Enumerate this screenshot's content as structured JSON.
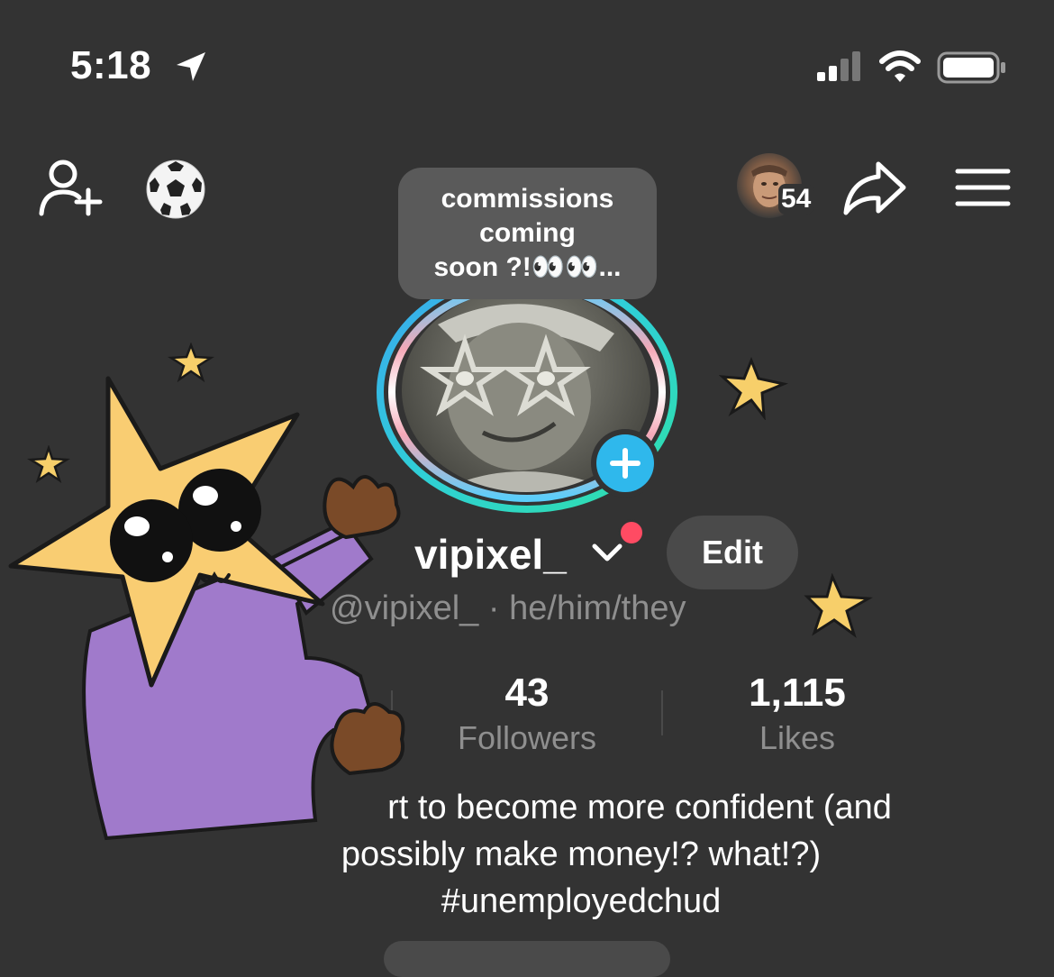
{
  "status_bar": {
    "time": "5:18",
    "icons": [
      "location-arrow-icon",
      "signal-icon",
      "wifi-icon",
      "battery-icon"
    ]
  },
  "top_nav": {
    "left_icons": [
      "add-friend-icon",
      "soccer-ball-icon"
    ],
    "visitor_count": "54",
    "right_icons": [
      "share-icon",
      "menu-icon"
    ]
  },
  "profile": {
    "note_bubble": {
      "line1": "commissions",
      "line2": "coming",
      "line3": "soon ?!👀👀..."
    },
    "username": "vipixel_",
    "edit_label": "Edit",
    "handle_line": "@vipixel_ · he/him/they",
    "stats": {
      "followers_count": "43",
      "followers_label": "Followers",
      "likes_count": "1,115",
      "likes_label": "Likes"
    },
    "bio": {
      "line1": "rt to become more confident (and",
      "line2": "possibly make money!? what!?)",
      "line3": "#unemployedchud"
    }
  },
  "colors": {
    "background": "#333333",
    "accent_blue": "#2fb8ec",
    "ring_teal": "#2fe0c0",
    "notification_red": "#ff4b63",
    "muted_text": "#8f8f8f"
  }
}
